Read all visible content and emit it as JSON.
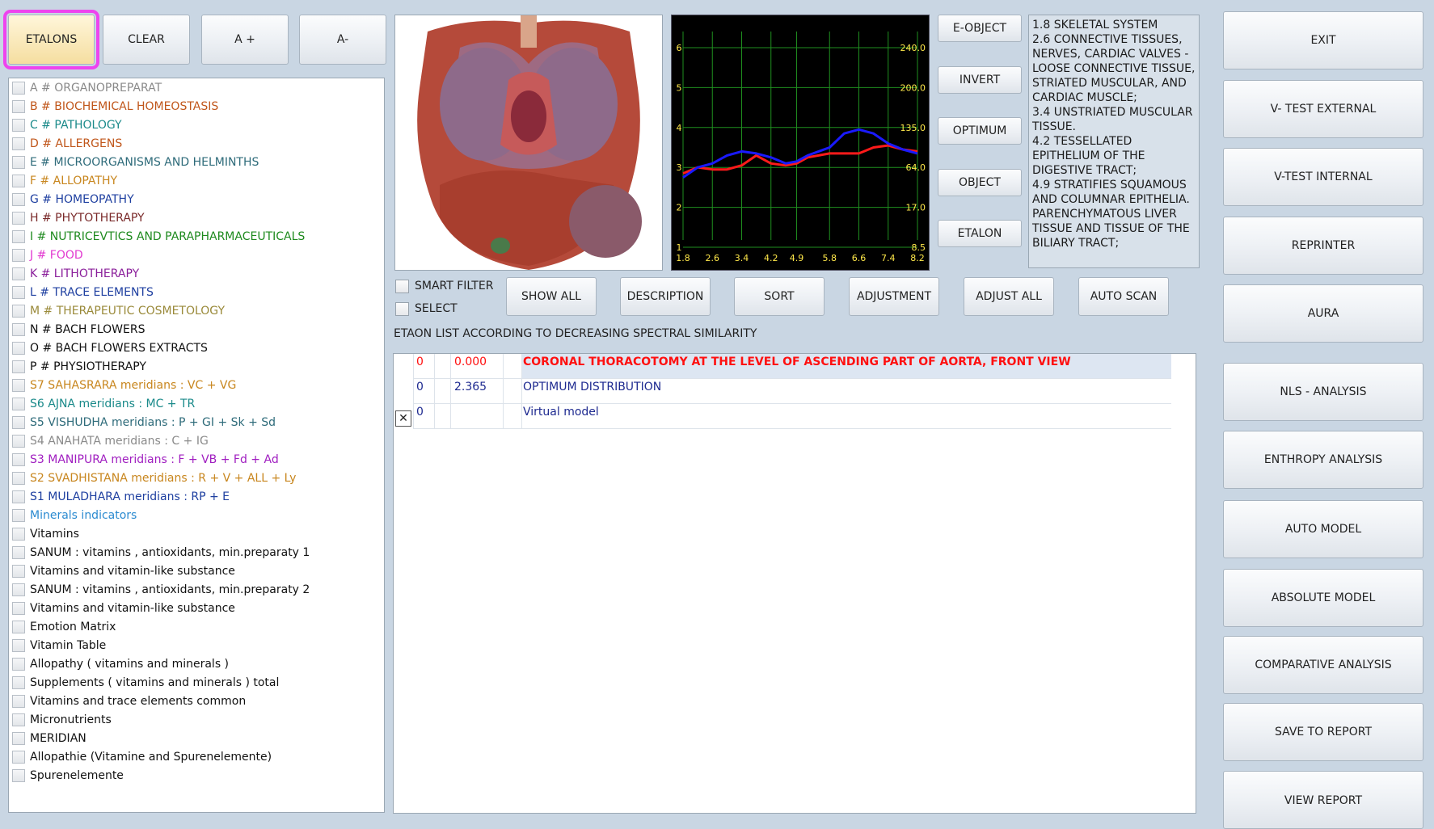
{
  "toolbar": {
    "etalons": "ETALONS",
    "clear": "CLEAR",
    "a_plus": "A +",
    "a_minus": "A-"
  },
  "categories": [
    {
      "label": "A # ORGANOPREPARAT",
      "color": "#8a8a8a"
    },
    {
      "label": "B # BIOCHEMICAL HOMEOSTASIS",
      "color": "#c0561a"
    },
    {
      "label": "C # PATHOLOGY",
      "color": "#1a8a8a"
    },
    {
      "label": "D # ALLERGENS",
      "color": "#c0561a"
    },
    {
      "label": "E # MICROORGANISMS AND HELMINTHS",
      "color": "#2e6b7a"
    },
    {
      "label": "F # ALLOPATHY",
      "color": "#c8861e"
    },
    {
      "label": "G # HOMEOPATHY",
      "color": "#1e3fa0"
    },
    {
      "label": "H # PHYTOTHERAPY",
      "color": "#7a2a2a"
    },
    {
      "label": "I # NUTRICEVTICS AND PARAPHARMACEUTICALS",
      "color": "#1e8a1e"
    },
    {
      "label": "J # FOOD",
      "color": "#e23ad0"
    },
    {
      "label": "K # LITHOTHERAPY",
      "color": "#8a1e9a"
    },
    {
      "label": "L # TRACE ELEMENTS",
      "color": "#1e3fa0"
    },
    {
      "label": "M # THERAPEUTIC COSMETOLOGY",
      "color": "#9a8a3a"
    },
    {
      "label": "N # BACH FLOWERS",
      "color": "#111111"
    },
    {
      "label": "O # BACH FLOWERS EXTRACTS",
      "color": "#111111"
    },
    {
      "label": "P # PHYSIOTHERAPY",
      "color": "#111111"
    },
    {
      "label": "S7 SAHASRARA meridians : VC + VG",
      "color": "#c8861e"
    },
    {
      "label": "S6 AJNA meridians : MC + TR",
      "color": "#1a8a8a"
    },
    {
      "label": "S5 VISHUDHA meridians : P + GI + Sk + Sd",
      "color": "#2e6b7a"
    },
    {
      "label": "S4 ANAHATA meridians : C + IG",
      "color": "#8a8a8a"
    },
    {
      "label": "S3 MANIPURA meridians : F + VB + Fd + Ad",
      "color": "#a01ec0"
    },
    {
      "label": "S2 SVADHISTANA meridians : R + V + ALL + Ly",
      "color": "#c8861e"
    },
    {
      "label": "S1 MULADHARA meridians : RP + E",
      "color": "#1e3fa0"
    },
    {
      "label": "Minerals indicators",
      "color": "#2a8ad0"
    },
    {
      "label": "Vitamins",
      "color": "#111111"
    },
    {
      "label": "SANUM : vitamins , antioxidants, min.preparaty 1",
      "color": "#111111"
    },
    {
      "label": "Vitamins and vitamin-like substance",
      "color": "#111111"
    },
    {
      "label": "SANUM : vitamins , antioxidants, min.preparaty 2",
      "color": "#111111"
    },
    {
      "label": "Vitamins and vitamin-like substance",
      "color": "#111111"
    },
    {
      "label": "Emotion Matrix",
      "color": "#111111"
    },
    {
      "label": "Vitamin Table",
      "color": "#111111"
    },
    {
      "label": "Allopathy ( vitamins and minerals )",
      "color": "#111111"
    },
    {
      "label": "Supplements ( vitamins and minerals ) total",
      "color": "#111111"
    },
    {
      "label": "Vitamins and trace elements common",
      "color": "#111111"
    },
    {
      "label": "Micronutrients",
      "color": "#111111"
    },
    {
      "label": "MERIDIAN",
      "color": "#111111"
    },
    {
      "label": "Allopathie (Vitamine and Spurenelemente)",
      "color": "#111111"
    },
    {
      "label": "Spurenelemente",
      "color": "#111111"
    }
  ],
  "chart_data": {
    "type": "line",
    "x": [
      1.8,
      2.6,
      3.4,
      4.2,
      4.9,
      5.8,
      6.6,
      7.4,
      8.2
    ],
    "left_ticks": [
      "1",
      "2",
      "3",
      "4",
      "5",
      "6"
    ],
    "right_ticks": [
      "8.5",
      "17.0",
      "64.0",
      "135.0",
      "200.0",
      "240.0"
    ],
    "ylim": [
      1,
      6
    ],
    "series": [
      {
        "color": "#ff1a1a",
        "points": [
          [
            1.8,
            2.85
          ],
          [
            2.2,
            3.0
          ],
          [
            2.6,
            2.95
          ],
          [
            3.0,
            2.95
          ],
          [
            3.4,
            3.05
          ],
          [
            3.8,
            3.3
          ],
          [
            4.2,
            3.1
          ],
          [
            4.6,
            3.05
          ],
          [
            4.9,
            3.1
          ],
          [
            5.2,
            3.25
          ],
          [
            5.8,
            3.35
          ],
          [
            6.2,
            3.35
          ],
          [
            6.6,
            3.35
          ],
          [
            7.0,
            3.5
          ],
          [
            7.4,
            3.55
          ],
          [
            7.8,
            3.45
          ],
          [
            8.2,
            3.4
          ]
        ]
      },
      {
        "color": "#1a1aff",
        "points": [
          [
            1.8,
            2.75
          ],
          [
            2.2,
            3.0
          ],
          [
            2.6,
            3.1
          ],
          [
            3.0,
            3.3
          ],
          [
            3.4,
            3.4
          ],
          [
            3.8,
            3.35
          ],
          [
            4.2,
            3.25
          ],
          [
            4.6,
            3.1
          ],
          [
            4.9,
            3.15
          ],
          [
            5.2,
            3.3
          ],
          [
            5.8,
            3.5
          ],
          [
            6.2,
            3.85
          ],
          [
            6.6,
            3.95
          ],
          [
            7.0,
            3.85
          ],
          [
            7.4,
            3.6
          ],
          [
            7.8,
            3.45
          ],
          [
            8.2,
            3.35
          ]
        ]
      }
    ]
  },
  "side_buttons": {
    "e_object": "E-OBJECT",
    "invert": "INVERT",
    "optimum": "OPTIMUM",
    "object": "OBJECT",
    "etalon": "ETALON"
  },
  "info_text": "1.8 SKELETAL SYSTEM\n2.6 CONNECTIVE TISSUES, NERVES, CARDIAC VALVES - LOOSE CONNECTIVE TISSUE, STRIATED MUSCULAR, AND CARDIAC MUSCLE;\n3.4 UNSTRIATED MUSCULAR TISSUE.\n4.2 TESSELLATED EPITHELIUM OF THE DIGESTIVE TRACT;\n4.9 STRATIFIES SQUAMOUS AND COLUMNAR EPITHELIA. PARENCHYMATOUS LIVER TISSUE AND TISSUE OF THE BILIARY TRACT;",
  "filters": {
    "smart_filter": "SMART FILTER",
    "select": "SELECT"
  },
  "action_buttons": {
    "show_all": "SHOW ALL",
    "description": "DESCRIPTION",
    "sort": "SORT",
    "adjustment": "ADJUSTMENT",
    "adjust_all": "ADJUST ALL",
    "auto_scan": "AUTO SCAN"
  },
  "results_caption": "ETAON LIST ACCORDING TO DECREASING SPECTRAL SIMILARITY",
  "results": [
    {
      "mark": "",
      "num": "0",
      "value": "0.000",
      "name": "CORONAL THORACOTOMY AT THE LEVEL OF ASCENDING PART OF AORTA, FRONT VIEW",
      "color": "#ff1010",
      "bold": true,
      "selected": true
    },
    {
      "mark": "",
      "num": "0",
      "value": "2.365",
      "name": "OPTIMUM DISTRIBUTION",
      "color": "#1e2a90",
      "bold": false,
      "selected": false
    },
    {
      "mark": "✕",
      "num": "0",
      "value": "",
      "name": "Virtual model",
      "color": "#1e2a90",
      "bold": false,
      "selected": false
    }
  ],
  "right_buttons": {
    "exit": "EXIT",
    "v_test_external": "V- TEST EXTERNAL",
    "v_test_internal": "V-TEST INTERNAL",
    "reprinter": "REPRINTER",
    "aura": "AURA",
    "nls_analysis": "NLS - ANALYSIS",
    "enthropy_analysis": "ENTHROPY ANALYSIS",
    "auto_model": "AUTO MODEL",
    "absolute_model": "ABSOLUTE MODEL",
    "comparative_analysis": "COMPARATIVE ANALYSIS",
    "save_to_report": "SAVE TO REPORT",
    "view_report": "VIEW REPORT"
  }
}
